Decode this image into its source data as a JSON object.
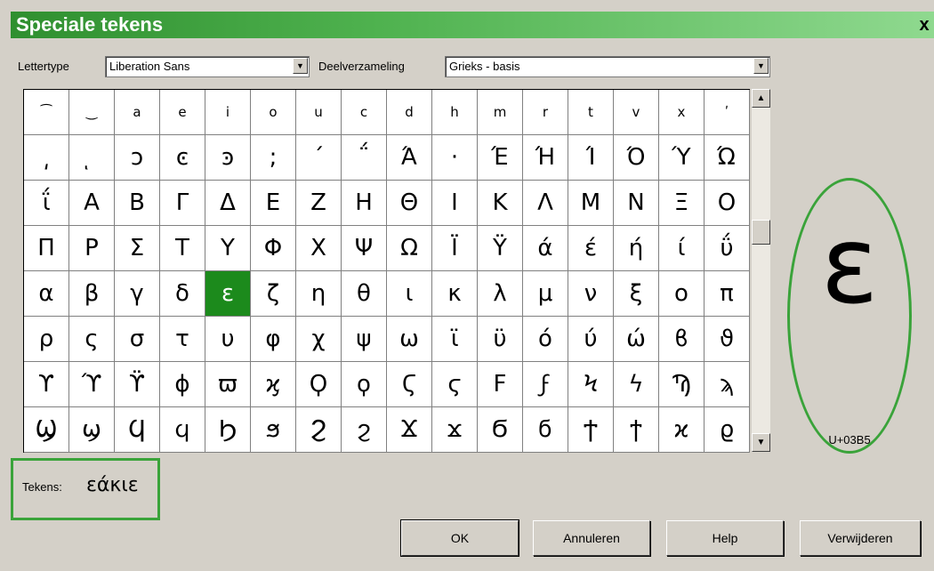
{
  "window": {
    "title": "Speciale tekens",
    "close_label": "x"
  },
  "font": {
    "label": "Lettertype",
    "value": "Liberation Sans"
  },
  "subset": {
    "label": "Deelverzameling",
    "value": "Grieks - basis"
  },
  "grid": {
    "rows": [
      [
        "⁀",
        "‿",
        "a",
        "e",
        "i",
        "o",
        "u",
        "c",
        "d",
        "h",
        "m",
        "r",
        "t",
        "v",
        "x",
        "ʹ"
      ],
      [
        "͵",
        "ͅ",
        "ͻ",
        "ͼ",
        "ͽ",
        ";",
        "΄",
        "΅",
        "Ά",
        "·",
        "Έ",
        "Ή",
        "Ί",
        "Ό",
        "Ύ",
        "Ώ"
      ],
      [
        "ΐ",
        "Α",
        "Β",
        "Γ",
        "Δ",
        "Ε",
        "Ζ",
        "Η",
        "Θ",
        "Ι",
        "Κ",
        "Λ",
        "Μ",
        "Ν",
        "Ξ",
        "Ο"
      ],
      [
        "Π",
        "Ρ",
        "Σ",
        "Τ",
        "Υ",
        "Φ",
        "Χ",
        "Ψ",
        "Ω",
        "Ϊ",
        "Ϋ",
        "ά",
        "έ",
        "ή",
        "ί",
        "ΰ"
      ],
      [
        "α",
        "β",
        "γ",
        "δ",
        "ε",
        "ζ",
        "η",
        "θ",
        "ι",
        "κ",
        "λ",
        "μ",
        "ν",
        "ξ",
        "ο",
        "π"
      ],
      [
        "ρ",
        "ς",
        "σ",
        "τ",
        "υ",
        "φ",
        "χ",
        "ψ",
        "ω",
        "ϊ",
        "ϋ",
        "ό",
        "ύ",
        "ώ",
        "ϐ",
        "ϑ"
      ],
      [
        "ϒ",
        "ϓ",
        "ϔ",
        "ϕ",
        "ϖ",
        "ϗ",
        "Ϙ",
        "ϙ",
        "Ϛ",
        "ϛ",
        "Ϝ",
        "ϝ",
        "Ϟ",
        "ϟ",
        "Ϡ",
        "ϡ"
      ],
      [
        "Ϣ",
        "ϣ",
        "Ϥ",
        "ϥ",
        "Ϧ",
        "ϧ",
        "Ϩ",
        "ϩ",
        "Ϫ",
        "ϫ",
        "Ϭ",
        "ϭ",
        "Ϯ",
        "ϯ",
        "ϰ",
        "ϱ"
      ]
    ],
    "selected_char": "ε"
  },
  "preview": {
    "char": "ε",
    "code": "U+03B5"
  },
  "tekens": {
    "label": "Tekens:",
    "value": "εάκιε"
  },
  "buttons": {
    "ok": "OK",
    "cancel": "Annuleren",
    "help": "Help",
    "delete": "Verwijderen"
  },
  "colors": {
    "selection": "#1c8a1c",
    "highlight": "#3aa33a"
  }
}
